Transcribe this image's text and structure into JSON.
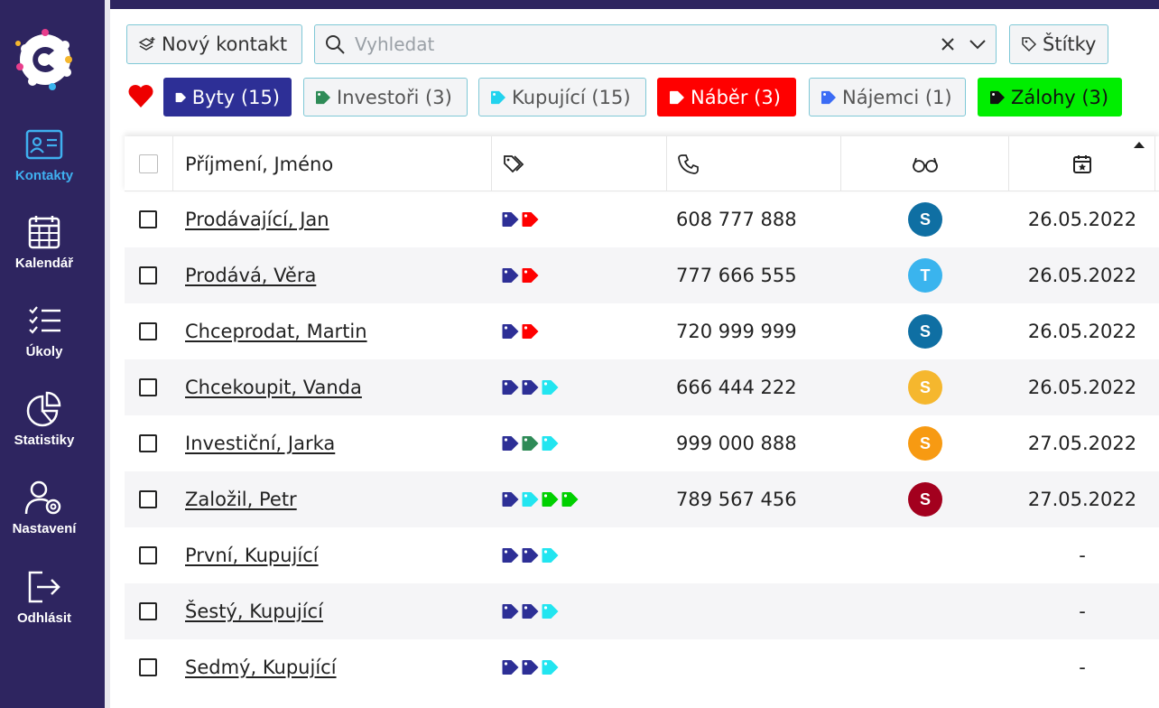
{
  "sidebar": {
    "items": [
      {
        "label": "Kontakty",
        "icon": "contacts-card-icon",
        "active": true
      },
      {
        "label": "Kalendář",
        "icon": "calendar-icon",
        "active": false
      },
      {
        "label": "Úkoly",
        "icon": "tasks-checklist-icon",
        "active": false
      },
      {
        "label": "Statistiky",
        "icon": "pie-chart-icon",
        "active": false
      },
      {
        "label": "Nastavení",
        "icon": "user-settings-icon",
        "active": false
      },
      {
        "label": "Odhlásit",
        "icon": "logout-icon",
        "active": false
      }
    ]
  },
  "toolbar": {
    "new_contact_label": "Nový kontakt",
    "search_placeholder": "Vyhledat",
    "labels_button": "Štítky"
  },
  "filters": [
    {
      "label": "Byty (15)",
      "bg": "#2d2f96",
      "fg": "#ffffff",
      "border": "#2d2f96",
      "icon_color": "#ffffff"
    },
    {
      "label": "Investoři (3)",
      "bg": "#f3f4f6",
      "fg": "#555555",
      "border": "#7fc8d6",
      "icon_color": "#2e8b57"
    },
    {
      "label": "Kupující (15)",
      "bg": "#f3f4f6",
      "fg": "#555555",
      "border": "#7fc8d6",
      "icon_color": "#22d3ee"
    },
    {
      "label": "Náběr (3)",
      "bg": "#ff0000",
      "fg": "#ffffff",
      "border": "#ff0000",
      "icon_color": "#ffffff"
    },
    {
      "label": "Nájemci (1)",
      "bg": "#f3f4f6",
      "fg": "#555555",
      "border": "#7fc8d6",
      "icon_color": "#3b6cf5"
    },
    {
      "label": "Zálohy (3)",
      "bg": "#00ee00",
      "fg": "#111111",
      "border": "#00ee00",
      "icon_color": "#111111"
    }
  ],
  "table": {
    "header": {
      "name": "Příjmení, Jméno"
    },
    "rows": [
      {
        "name": "Prodávající, Jan",
        "tags": [
          "#2d2f96",
          "#ff0000"
        ],
        "phone": "608 777 888",
        "avatar": "S",
        "avatar_color": "#0f6fa3",
        "date": "26.05.2022"
      },
      {
        "name": "Prodává, Věra",
        "tags": [
          "#2d2f96",
          "#ff0000"
        ],
        "phone": "777 666 555",
        "avatar": "T",
        "avatar_color": "#3ab4ee",
        "date": "26.05.2022"
      },
      {
        "name": "Chceprodat, Martin",
        "tags": [
          "#2d2f96",
          "#ff0000"
        ],
        "phone": "720 999 999",
        "avatar": "S",
        "avatar_color": "#0f6fa3",
        "date": "26.05.2022"
      },
      {
        "name": "Chcekoupit, Vanda",
        "tags": [
          "#2d2f96",
          "#2d2f96",
          "#22e5f0"
        ],
        "phone": "666 444 222",
        "avatar": "S",
        "avatar_color": "#f5b72e",
        "date": "26.05.2022"
      },
      {
        "name": "Investiční, Jarka",
        "tags": [
          "#2d2f96",
          "#2e8b57",
          "#22e5f0"
        ],
        "phone": "999 000 888",
        "avatar": "S",
        "avatar_color": "#f79a12",
        "date": "27.05.2022"
      },
      {
        "name": "Založil, Petr",
        "tags": [
          "#2d2f96",
          "#22e5f0",
          "#00d000",
          "#00d000"
        ],
        "phone": "789 567 456",
        "avatar": "S",
        "avatar_color": "#a3001e",
        "date": "27.05.2022"
      },
      {
        "name": "První, Kupující",
        "tags": [
          "#2d2f96",
          "#2d2f96",
          "#22e5f0"
        ],
        "phone": "",
        "avatar": "",
        "avatar_color": "",
        "date": "-"
      },
      {
        "name": "Šestý, Kupující",
        "tags": [
          "#2d2f96",
          "#2d2f96",
          "#22e5f0"
        ],
        "phone": "",
        "avatar": "",
        "avatar_color": "",
        "date": "-"
      },
      {
        "name": "Sedmý, Kupující",
        "tags": [
          "#2d2f96",
          "#2d2f96",
          "#22e5f0"
        ],
        "phone": "",
        "avatar": "",
        "avatar_color": "",
        "date": "-"
      }
    ]
  }
}
